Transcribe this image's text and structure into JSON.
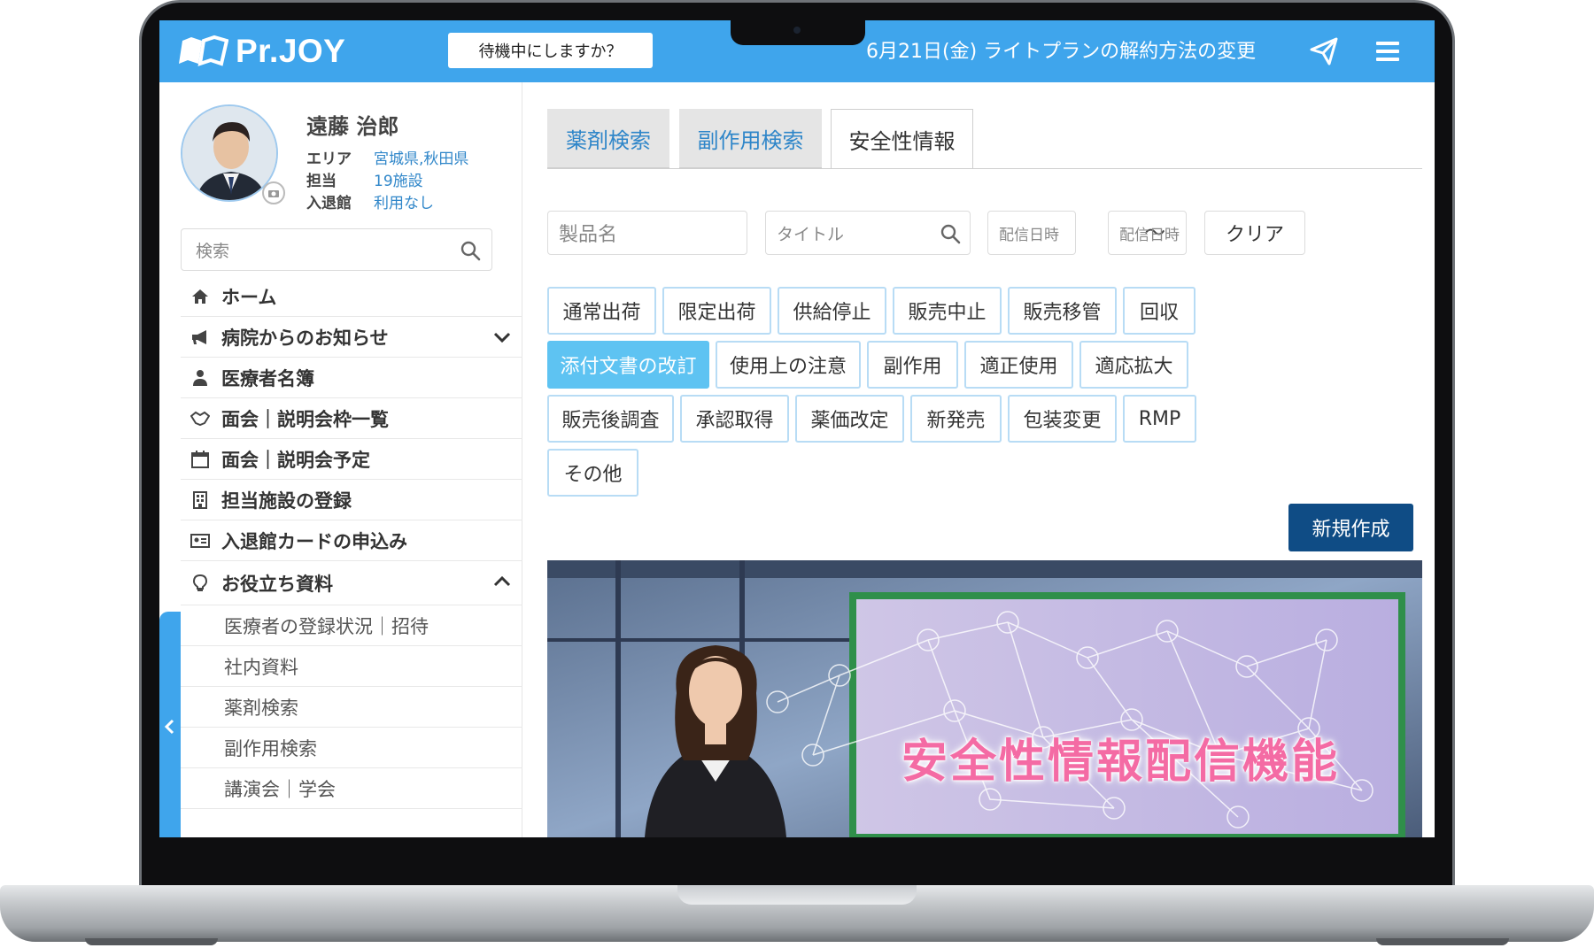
{
  "header": {
    "logo_text": "Pr.JOY",
    "standby_label": "待機中にしますか？",
    "announcement": "6月21日(金) ライトプランの解約方法の変更",
    "icons": {
      "send": "paper-plane-icon",
      "menu": "hamburger-menu-icon"
    },
    "color": "#3fa5ec"
  },
  "profile": {
    "name": "遠藤 治郎",
    "area_label": "エリア",
    "area_value": "宮城県,秋田県",
    "charge_label": "担当",
    "charge_value": "19施設",
    "entry_label": "入退館",
    "entry_value": "利用なし"
  },
  "sidebar": {
    "search_placeholder": "検索",
    "items": [
      {
        "label": "ホーム",
        "icon": "home-icon"
      },
      {
        "label": "病院からのお知らせ",
        "icon": "megaphone-icon"
      },
      {
        "label": "医療者名簿",
        "icon": "doctor-icon"
      },
      {
        "label": "面会｜説明会枠一覧",
        "icon": "handshake-icon"
      },
      {
        "label": "面会｜説明会予定",
        "icon": "calendar-icon"
      },
      {
        "label": "担当施設の登録",
        "icon": "building-icon"
      },
      {
        "label": "入退館カードの申込み",
        "icon": "id-card-icon"
      },
      {
        "label": "お役立ち資料",
        "icon": "lightbulb-icon"
      }
    ],
    "subitems": [
      {
        "label": "医療者の登録状況｜招待"
      },
      {
        "label": "社内資料"
      },
      {
        "label": "薬剤検索"
      },
      {
        "label": "副作用検索"
      },
      {
        "label": "講演会｜学会"
      }
    ]
  },
  "main": {
    "tabs": [
      {
        "label": "薬剤検索",
        "active": false
      },
      {
        "label": "副作用検索",
        "active": false
      },
      {
        "label": "安全性情報",
        "active": true
      }
    ],
    "filters": {
      "product_placeholder": "製品名",
      "title_placeholder": "タイトル",
      "date_from_placeholder": "配信日時",
      "date_separator": "〜",
      "date_to_placeholder": "配信日時",
      "clear_label": "クリア"
    },
    "categories": [
      {
        "label": "通常出荷",
        "selected": false
      },
      {
        "label": "限定出荷",
        "selected": false
      },
      {
        "label": "供給停止",
        "selected": false
      },
      {
        "label": "販売中止",
        "selected": false
      },
      {
        "label": "販売移管",
        "selected": false
      },
      {
        "label": "回収",
        "selected": false
      },
      {
        "label": "添付文書の改訂",
        "selected": true
      },
      {
        "label": "使用上の注意",
        "selected": false
      },
      {
        "label": "副作用",
        "selected": false
      },
      {
        "label": "適正使用",
        "selected": false
      },
      {
        "label": "適応拡大",
        "selected": false
      },
      {
        "label": "販売後調査",
        "selected": false
      },
      {
        "label": "承認取得",
        "selected": false
      },
      {
        "label": "薬価改定",
        "selected": false
      },
      {
        "label": "新発売",
        "selected": false
      },
      {
        "label": "包装変更",
        "selected": false
      },
      {
        "label": "RMP",
        "selected": false
      },
      {
        "label": "その他",
        "selected": false
      }
    ],
    "new_button_label": "新規作成",
    "video_caption": "安全性情報配信機能"
  },
  "colors": {
    "accent": "#3fa5ec",
    "link": "#2f86c9",
    "selected_category": "#5ec3f2",
    "primary_button": "#0f4c85",
    "caption": "#f46ba4"
  }
}
